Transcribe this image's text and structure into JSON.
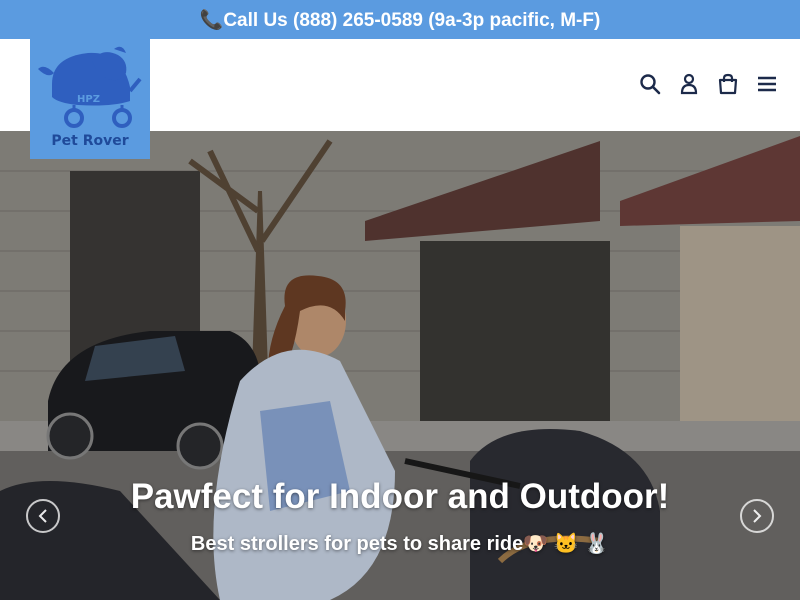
{
  "announcement": {
    "text": "📞Call Us (888) 265-0589 (9a-3p pacific, M-F)"
  },
  "logo": {
    "brand": "Pet Rover",
    "mark": "HPZ"
  },
  "header": {
    "icons": [
      "search-icon",
      "account-icon",
      "cart-icon",
      "menu-icon"
    ]
  },
  "hero": {
    "title": "Pawfect for Indoor and Outdoor!",
    "subtitle": "Best strollers for pets to share ride🐶 🐱 🐰"
  },
  "colors": {
    "accent": "#5b9be0",
    "logo_text": "#1f4a9a",
    "icon": "#1c2a4a"
  }
}
